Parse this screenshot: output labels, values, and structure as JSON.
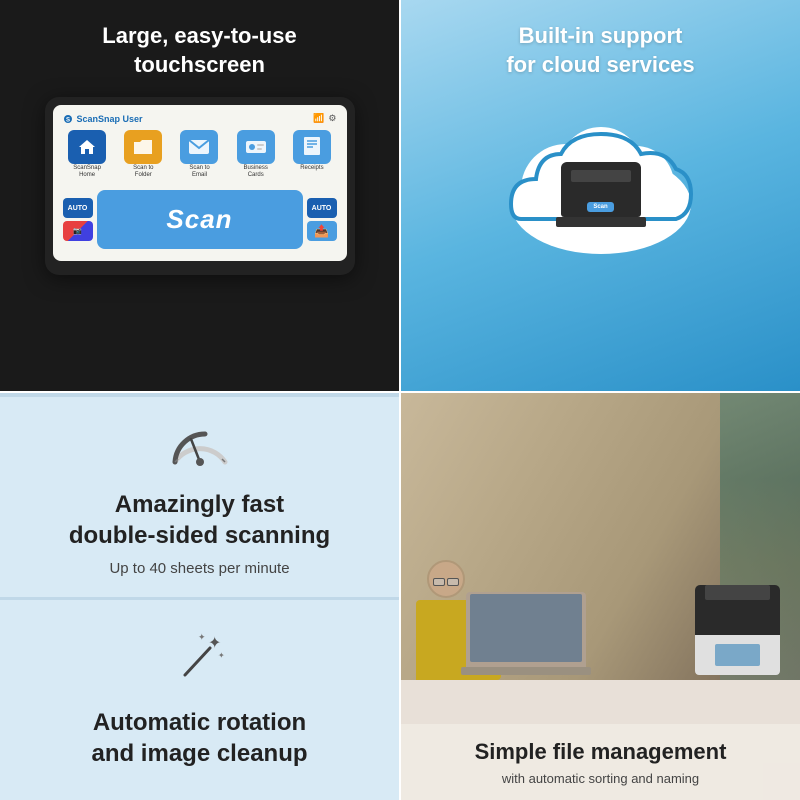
{
  "topLeft": {
    "title": "Large, easy-to-use\ntouchscreen",
    "screen": {
      "user": "ScanSnap User",
      "apps": [
        {
          "label": "ScanSnap\nHome",
          "bg": "home"
        },
        {
          "label": "Scan to\nFolder",
          "bg": "folder"
        },
        {
          "label": "Scan to\nEmail",
          "bg": "email"
        },
        {
          "label": "Business\nCards",
          "bg": "cards"
        },
        {
          "label": "Receipts",
          "bg": "receipts"
        }
      ],
      "scanButton": "Scan",
      "autoBadge": "AUTO"
    }
  },
  "topRight": {
    "title": "Built-in support\nfor cloud services",
    "scannerLabel": "Scan"
  },
  "bottomLeft": {
    "title": "Amazingly fast\ndouble-sided scanning",
    "subtitle": "Up to 40 sheets per minute"
  },
  "bottomLeft2": {
    "title": "Automatic rotation\nand image cleanup"
  },
  "bottomRight": {
    "title": "Simple file management",
    "subtitle": "with automatic sorting and naming"
  }
}
